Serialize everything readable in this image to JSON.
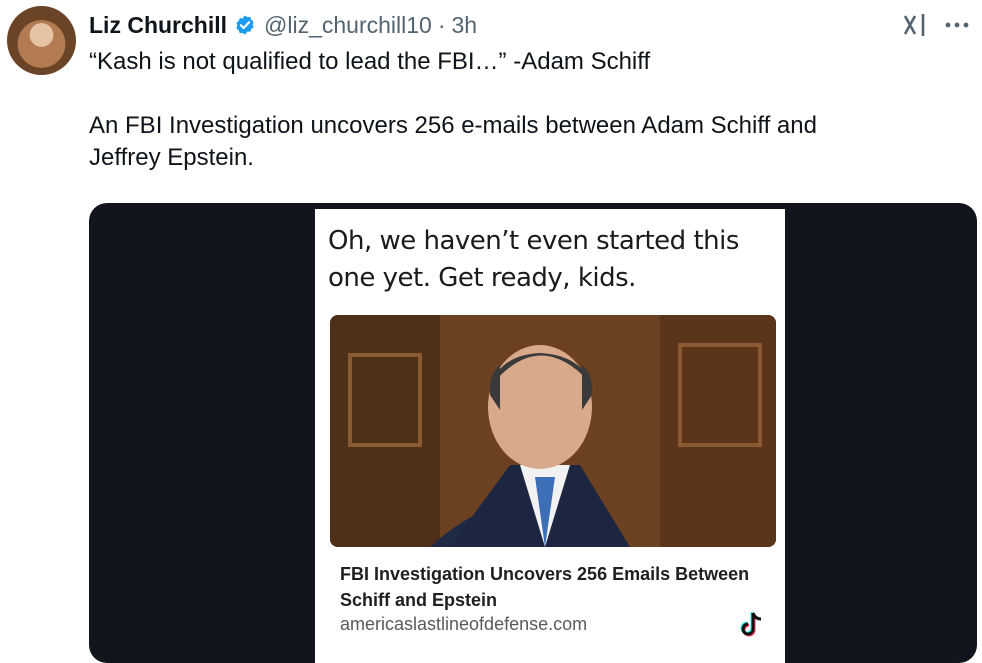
{
  "author": {
    "name": "Liz Churchill",
    "handle": "@liz_churchill10",
    "separator": "·",
    "time": "3h"
  },
  "icons": {
    "avatar": "avatar",
    "verified": "verified-badge-icon",
    "grok": "grok-icon",
    "more": "more-icon",
    "tiktok": "tiktok-icon"
  },
  "colors": {
    "verified": "#1d9bf0",
    "secondary_text": "#536471",
    "media_bg": "#12161c"
  },
  "tweet": {
    "text": "“Kash is not qualified to lead the FBI…” -Adam Schiff\n\nAn FBI Investigation uncovers 256 e-mails between Adam Schiff and\nJeffrey Epstein."
  },
  "media": {
    "caption": "Oh, we haven’t even started this one yet. Get ready, kids.",
    "article_title": "FBI Investigation Uncovers 256 Emails Between Schiff and Epstein",
    "article_url": "americaslastlineofdefense.com"
  }
}
